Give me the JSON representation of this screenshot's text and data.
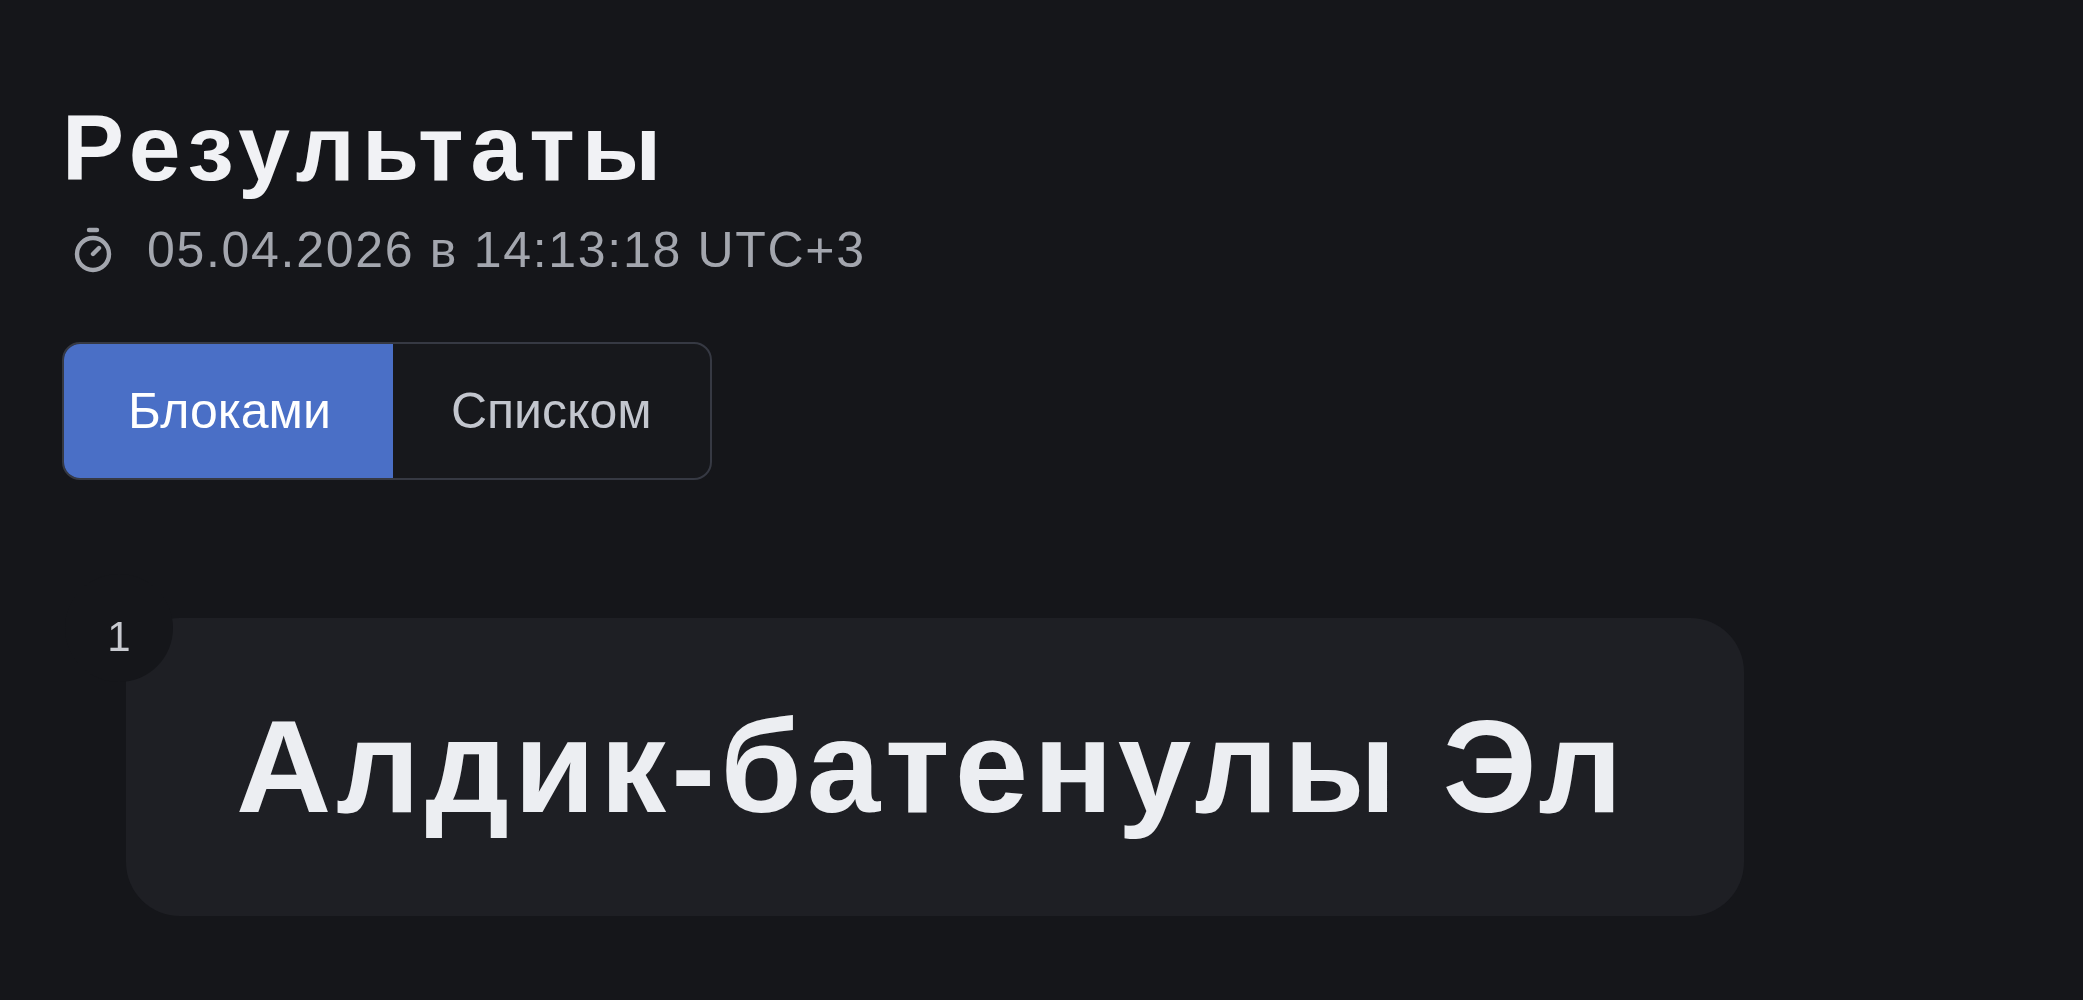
{
  "page": {
    "title": "Результаты",
    "timestamp": "05.04.2026 в 14:13:18 UTC+3"
  },
  "view_tabs": [
    {
      "label": "Блоками",
      "selected": true
    },
    {
      "label": "Списком",
      "selected": false
    }
  ],
  "results": [
    {
      "number": "1",
      "name": "Алдик-батенулы Эл"
    }
  ]
}
